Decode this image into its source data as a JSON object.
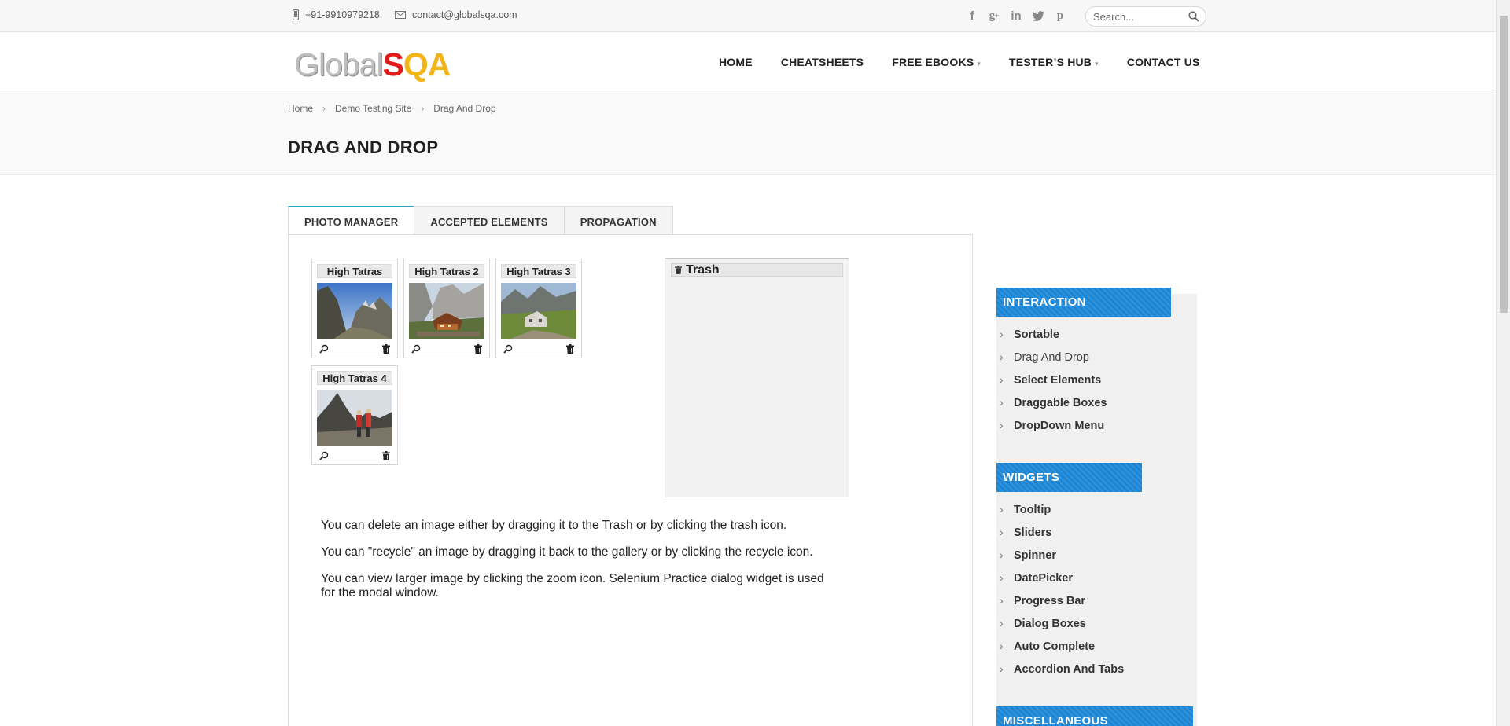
{
  "topbar": {
    "phone": "+91-9910979218",
    "email": "contact@globalsqa.com",
    "social": [
      "facebook-icon",
      "google-plus-icon",
      "linkedin-icon",
      "twitter-icon",
      "pinterest-icon"
    ],
    "search_placeholder": "Search..."
  },
  "logo": {
    "part1": "Global",
    "part2": "S",
    "part3": "QA"
  },
  "nav": {
    "home": "HOME",
    "cheatsheets": "CHEATSHEETS",
    "ebooks": "FREE EBOOKS",
    "hub": "TESTER’S HUB",
    "contact": "CONTACT US"
  },
  "breadcrumb": {
    "home": "Home",
    "demo": "Demo Testing Site",
    "current": "Drag And Drop",
    "sep": "›"
  },
  "page_title": "DRAG AND DROP",
  "tabs": [
    "PHOTO MANAGER",
    "ACCEPTED ELEMENTS",
    "PROPAGATION"
  ],
  "gallery": [
    {
      "title": "High Tatras"
    },
    {
      "title": "High Tatras 2"
    },
    {
      "title": "High Tatras 3"
    },
    {
      "title": "High Tatras 4"
    }
  ],
  "trash": {
    "title": "Trash"
  },
  "description": [
    "You can delete an image either by dragging it to the Trash or by clicking the trash icon.",
    "You can \"recycle\" an image by dragging it back to the gallery or by clicking the recycle icon.",
    "You can view larger image by clicking the zoom icon. Selenium Practice dialog widget is used for the modal window."
  ],
  "sidebar": {
    "interaction": {
      "title": "INTERACTION",
      "items": [
        "Sortable",
        "Drag And Drop",
        "Select Elements",
        "Draggable Boxes",
        "DropDown Menu"
      ]
    },
    "widgets": {
      "title": "WIDGETS",
      "items": [
        "Tooltip",
        "Sliders",
        "Spinner",
        "DatePicker",
        "Progress Bar",
        "Dialog Boxes",
        "Auto Complete",
        "Accordion And Tabs"
      ]
    },
    "misc": {
      "title": "MISCELLANEOUS"
    }
  },
  "colors": {
    "accent": "#26a2d6",
    "sidebar_header": "#1b86d6",
    "logo_red": "#e21a1a",
    "logo_yellow": "#f2b417"
  }
}
